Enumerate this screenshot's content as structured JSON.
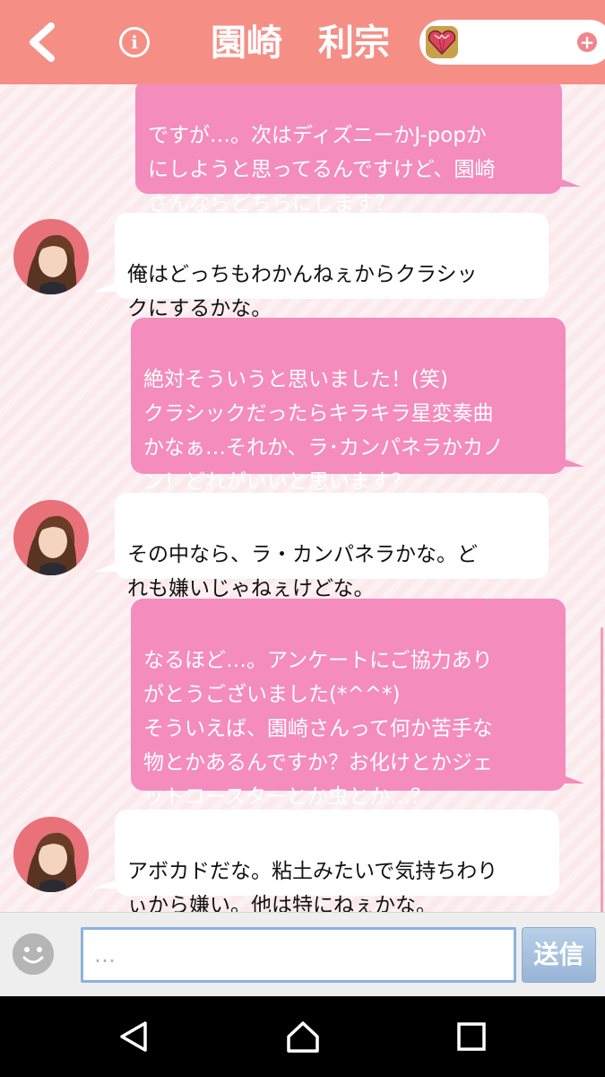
{
  "header": {
    "title": "園崎　利宗",
    "back_icon": "back-chevron-icon",
    "info_icon": "info-icon",
    "gem_icon": "heart-gem-icon",
    "add_icon": "plus-icon",
    "info_label": "i",
    "add_label": "+",
    "colors": {
      "bar": "#f58f86"
    }
  },
  "messages": [
    {
      "sender": "user",
      "text": "ですが…。次はディズニーかJ-popか\nにしようと思ってるんですけど、園崎\nさんならどちらにします？"
    },
    {
      "sender": "partner",
      "text": "俺はどっちもわかんねぇからクラシッ\nクにするかな。"
    },
    {
      "sender": "user",
      "text": "絶対そういうと思いました！(笑)\nクラシックだったらキラキラ星変奏曲\nかなぁ…それか、ラ･カンパネラかカノ\nン！どれがいいと思います？"
    },
    {
      "sender": "partner",
      "text": "その中なら、ラ・カンパネラかな。ど\nれも嫌いじゃねぇけどな。"
    },
    {
      "sender": "user",
      "text": "なるほど…。アンケートにご協力あり\nがとうございました(*^^*)\nそういえば、園崎さんって何か苦手な\n物とかあるんですか？お化けとかジェ\nットコースターとか虫とか…？"
    },
    {
      "sender": "partner",
      "text": "アボカドだな。粘土みたいで気持ちわり\nぃから嫌い。他は特にねぇかな。"
    }
  ],
  "composer": {
    "placeholder": "…",
    "send_label": "送信",
    "emoji_icon": "smiley-icon"
  },
  "navbar": {
    "back_icon": "nav-back-icon",
    "home_icon": "nav-home-icon",
    "recents_icon": "nav-recents-icon"
  },
  "colors": {
    "user_bubble": "#f48cbd",
    "partner_bubble": "#ffffff",
    "chat_bg": "#fbe9ec",
    "send_button": "#a9c2e0"
  }
}
